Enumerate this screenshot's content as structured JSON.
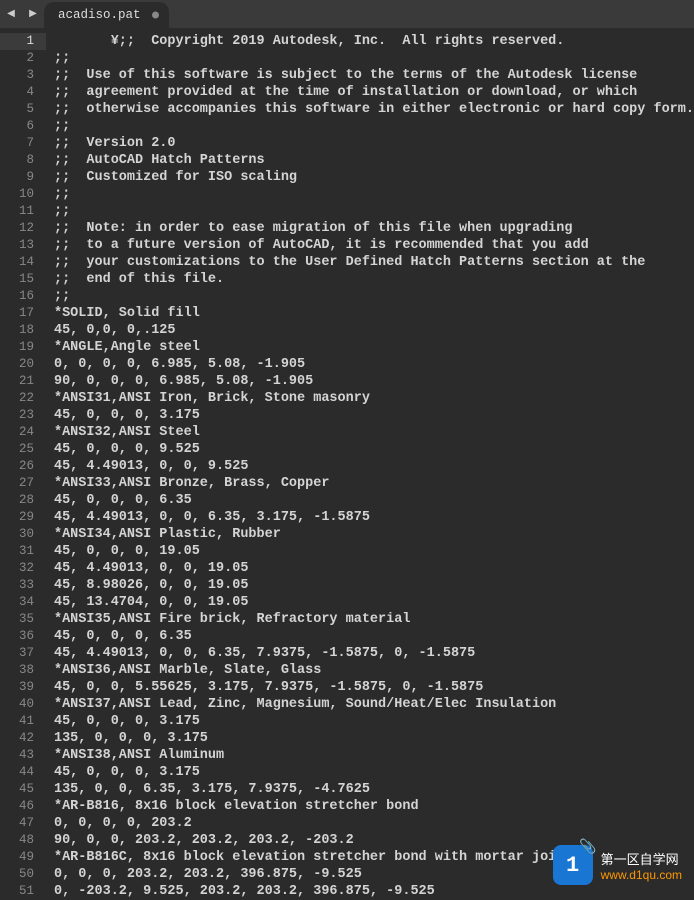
{
  "tab": {
    "filename": "acadiso.pat",
    "dirty": true
  },
  "arrows": {
    "left": "◀",
    "right": "▶"
  },
  "active_line": 1,
  "lines": [
    "       ¥;;  Copyright 2019 Autodesk, Inc.  All rights reserved.",
    ";;",
    ";;  Use of this software is subject to the terms of the Autodesk license",
    ";;  agreement provided at the time of installation or download, or which",
    ";;  otherwise accompanies this software in either electronic or hard copy form.",
    ";;",
    ";;  Version 2.0",
    ";;  AutoCAD Hatch Patterns",
    ";;  Customized for ISO scaling",
    ";;",
    ";;",
    ";;  Note: in order to ease migration of this file when upgrading",
    ";;  to a future version of AutoCAD, it is recommended that you add",
    ";;  your customizations to the User Defined Hatch Patterns section at the",
    ";;  end of this file.",
    ";;",
    "*SOLID, Solid fill",
    "45, 0,0, 0,.125",
    "*ANGLE,Angle steel",
    "0, 0, 0, 0, 6.985, 5.08, -1.905",
    "90, 0, 0, 0, 6.985, 5.08, -1.905",
    "*ANSI31,ANSI Iron, Brick, Stone masonry",
    "45, 0, 0, 0, 3.175",
    "*ANSI32,ANSI Steel",
    "45, 0, 0, 0, 9.525",
    "45, 4.49013, 0, 0, 9.525",
    "*ANSI33,ANSI Bronze, Brass, Copper",
    "45, 0, 0, 0, 6.35",
    "45, 4.49013, 0, 0, 6.35, 3.175, -1.5875",
    "*ANSI34,ANSI Plastic, Rubber",
    "45, 0, 0, 0, 19.05",
    "45, 4.49013, 0, 0, 19.05",
    "45, 8.98026, 0, 0, 19.05",
    "45, 13.4704, 0, 0, 19.05",
    "*ANSI35,ANSI Fire brick, Refractory material",
    "45, 0, 0, 0, 6.35",
    "45, 4.49013, 0, 0, 6.35, 7.9375, -1.5875, 0, -1.5875",
    "*ANSI36,ANSI Marble, Slate, Glass",
    "45, 0, 0, 5.55625, 3.175, 7.9375, -1.5875, 0, -1.5875",
    "*ANSI37,ANSI Lead, Zinc, Magnesium, Sound/Heat/Elec Insulation",
    "45, 0, 0, 0, 3.175",
    "135, 0, 0, 0, 3.175",
    "*ANSI38,ANSI Aluminum",
    "45, 0, 0, 0, 3.175",
    "135, 0, 0, 6.35, 3.175, 7.9375, -4.7625",
    "*AR-B816, 8x16 block elevation stretcher bond",
    "0, 0, 0, 0, 203.2",
    "90, 0, 0, 203.2, 203.2, 203.2, -203.2",
    "*AR-B816C, 8x16 block elevation stretcher bond with mortar joints",
    "0, 0, 0, 203.2, 203.2, 396.875, -9.525",
    "0, -203.2, 9.525, 203.2, 203.2, 396.875, -9.525"
  ],
  "watermark": {
    "badge": "1",
    "cn": "第一区自学网",
    "url": "www.d1qu.com"
  }
}
